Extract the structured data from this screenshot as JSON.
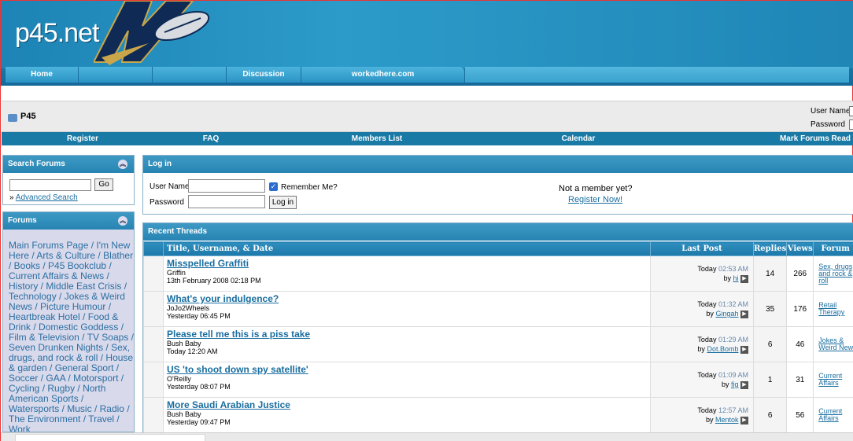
{
  "site": {
    "logo_text": "p45.net"
  },
  "topnav": {
    "items": [
      "Home",
      "",
      "",
      "Discussion",
      "workedhere.com"
    ]
  },
  "breadcrumb": {
    "title": "P45"
  },
  "mini_login": {
    "username_label": "User Name",
    "password_label": "Password"
  },
  "navbar": {
    "items": [
      "Register",
      "FAQ",
      "Members List",
      "Calendar",
      "Mark Forums Read"
    ]
  },
  "search_forums": {
    "title": "Search Forums",
    "go_label": "Go",
    "prefix": "»",
    "advanced_search": "Advanced Search"
  },
  "forums_panel": {
    "title": "Forums",
    "items": [
      "Main Forums Page",
      "I'm New Here",
      "Arts & Culture",
      "Blather",
      "Books",
      "P45 Bookclub",
      "Current Affairs & News",
      "History",
      "Middle East Crisis",
      "Technology",
      "Jokes & Weird News",
      "Picture Humour",
      "Heartbreak Hotel",
      "Food & Drink",
      "Domestic Goddess",
      "Film & Television",
      "TV Soaps",
      "Seven Drunken Nights",
      "Sex, drugs, and rock & roll",
      "House & garden",
      "General Sport",
      "Soccer",
      "GAA",
      "Motorsport",
      "Cycling",
      "Rugby",
      "North American Sports",
      "Watersports",
      "Music",
      "Radio",
      "The Environment",
      "Travel",
      "Work"
    ]
  },
  "login_panel": {
    "title": "Log in",
    "username_label": "User Name",
    "password_label": "Password",
    "remember_me": "Remember Me?",
    "login_button": "Log in",
    "not_member": "Not a member yet?",
    "register_now": "Register Now!"
  },
  "recent_threads": {
    "title": "Recent Threads",
    "columns": {
      "title": "Title, Username, & Date",
      "last_post": "Last Post",
      "replies": "Replies",
      "views": "Views",
      "forum": "Forum"
    },
    "rows": [
      {
        "title": "Misspelled Graffiti",
        "user": "Griffin",
        "date": "13th February 2008 02:18 PM",
        "last_day": "Today",
        "last_time": "02:53 AM",
        "last_by_prefix": "by",
        "last_by": "hi",
        "replies": "14",
        "views": "266",
        "forum": "Sex, drugs, and rock & roll"
      },
      {
        "title": "What's your indulgence?",
        "user": "JoJo2Wheels",
        "date": "Yesterday 06:45 PM",
        "last_day": "Today",
        "last_time": "01:32 AM",
        "last_by_prefix": "by",
        "last_by": "Gingah",
        "replies": "35",
        "views": "176",
        "forum": "Retail Therapy"
      },
      {
        "title": "Please tell me this is a piss take",
        "user": "Bush Baby",
        "date": "Today 12:20 AM",
        "last_day": "Today",
        "last_time": "01:29 AM",
        "last_by_prefix": "by",
        "last_by": "Dot.Bomb",
        "replies": "6",
        "views": "46",
        "forum": "Jokes & Weird News"
      },
      {
        "title": "US 'to shoot down spy satellite'",
        "user": "O'Reilly",
        "date": "Yesterday 08:07 PM",
        "last_day": "Today",
        "last_time": "01:09 AM",
        "last_by_prefix": "by",
        "last_by": "fig",
        "replies": "1",
        "views": "31",
        "forum": "Current Affairs"
      },
      {
        "title": "More Saudi Arabian Justice",
        "user": "Bush Baby",
        "date": "Yesterday 09:47 PM",
        "last_day": "Today",
        "last_time": "12:57 AM",
        "last_by_prefix": "by",
        "last_by": "Mentok",
        "replies": "6",
        "views": "56",
        "forum": "Current Affairs"
      }
    ]
  },
  "colors": {
    "header_blue": "#1d84b5",
    "navbar_blue": "#1a7aa6",
    "link": "#1a6ea0"
  },
  "icons": {
    "collapse": "double-chevron-up-icon",
    "go_arrow": "arrow-right-icon",
    "forum_icon": "folder-icon"
  }
}
